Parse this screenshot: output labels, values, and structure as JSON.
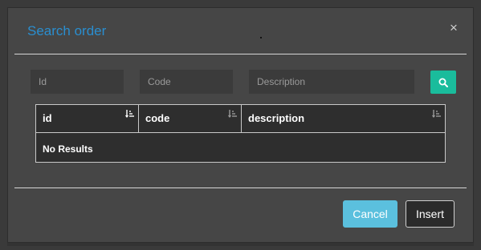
{
  "dialog": {
    "title": "Search order",
    "close_symbol": "×"
  },
  "filters": {
    "id_placeholder": "Id",
    "code_placeholder": "Code",
    "description_placeholder": "Description",
    "search_icon": "search-icon"
  },
  "table": {
    "columns": [
      {
        "label": "id",
        "sort_icon": "sort-ascending-icon"
      },
      {
        "label": "code",
        "sort_icon": "sort-icon"
      },
      {
        "label": "description",
        "sort_icon": "sort-icon"
      }
    ],
    "empty_message": "No Results"
  },
  "footer": {
    "cancel_label": "Cancel",
    "insert_label": "Insert"
  },
  "colors": {
    "accent": "#2a8ecf",
    "search_button": "#1abc9c",
    "cancel_button": "#5bc0de"
  }
}
